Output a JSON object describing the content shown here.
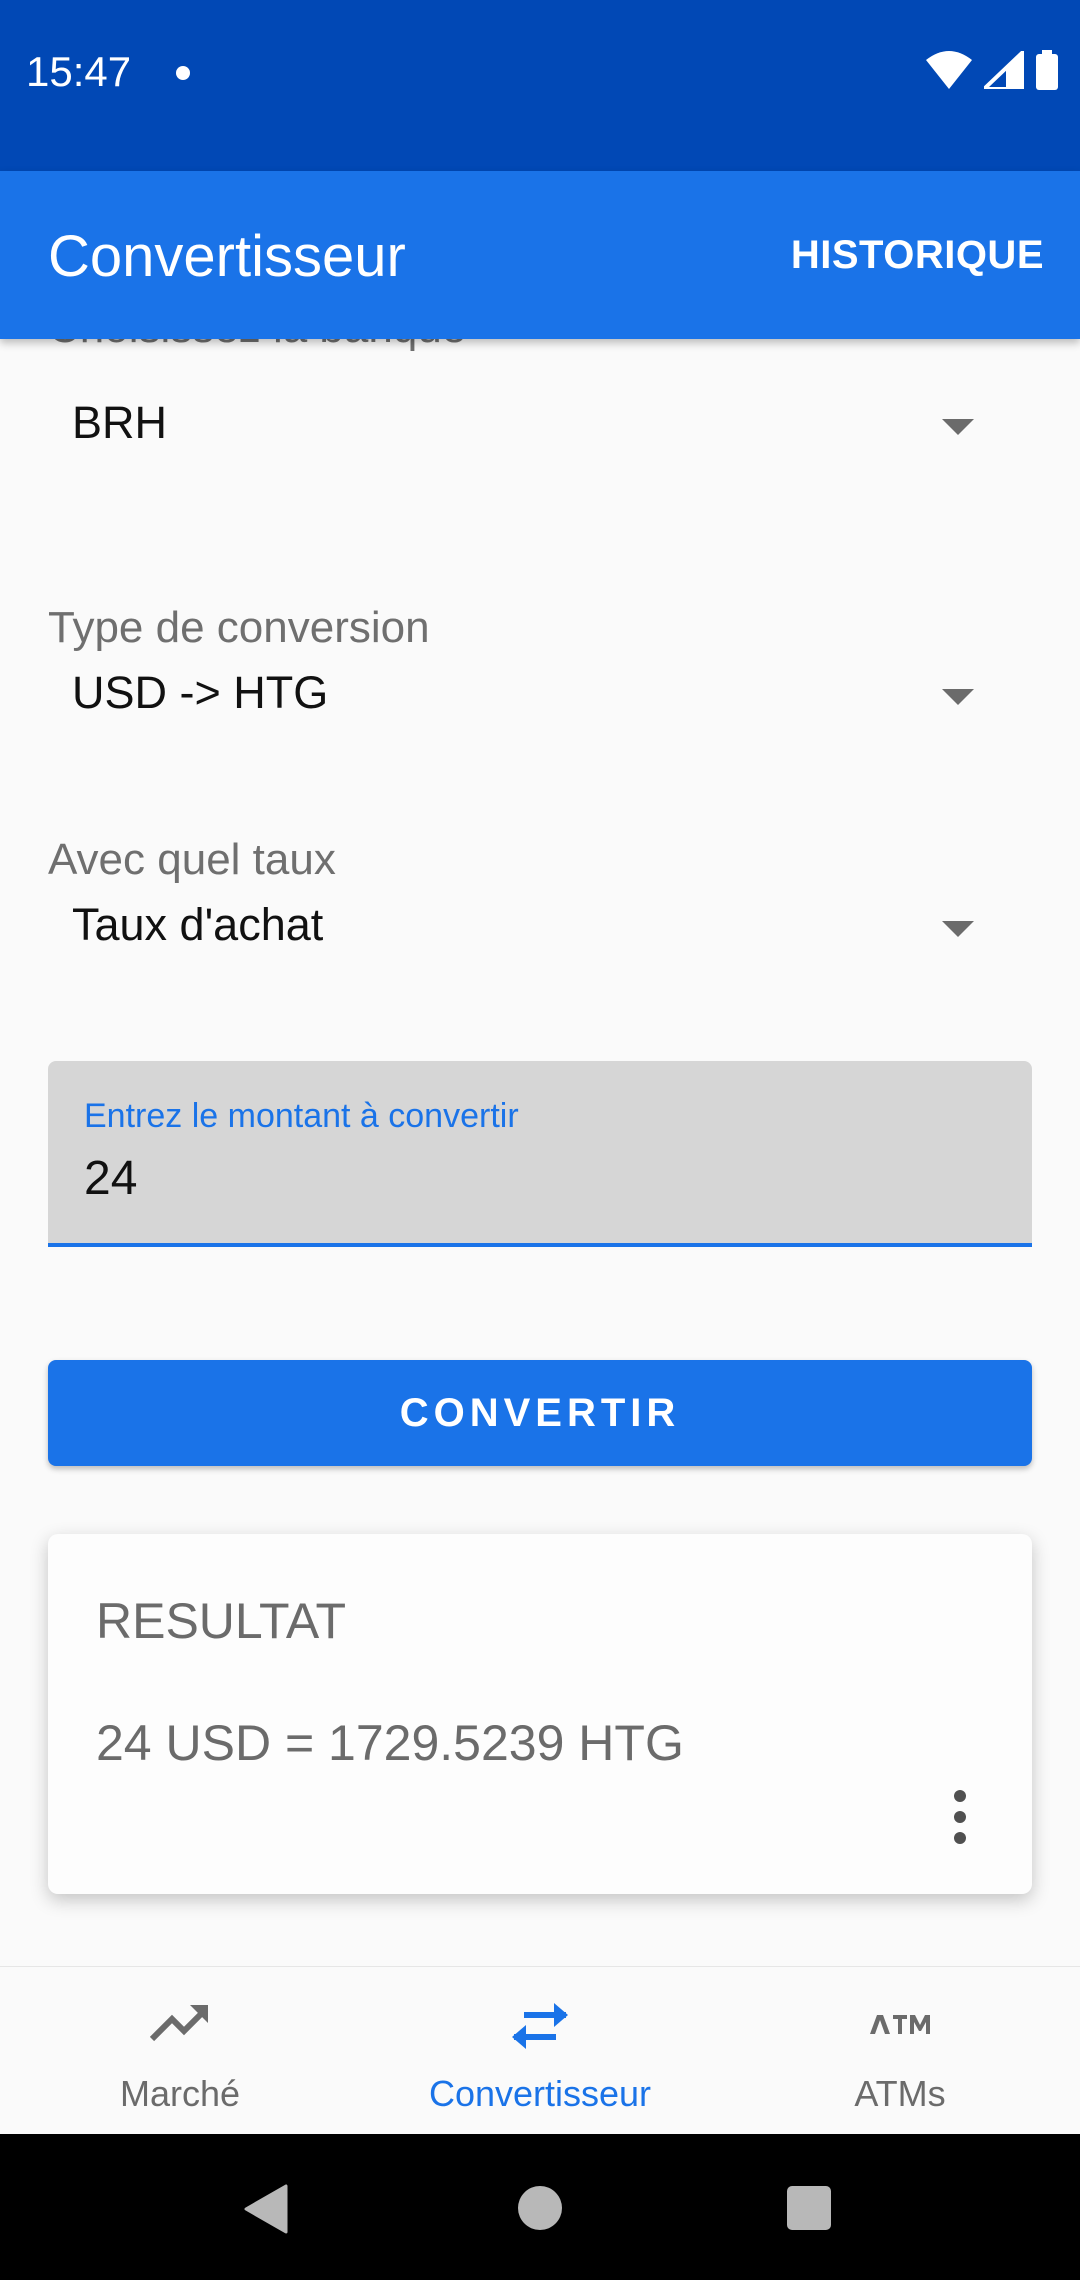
{
  "status_bar": {
    "time": "15:47"
  },
  "app_bar": {
    "title": "Convertisseur",
    "action": "HISTORIQUE"
  },
  "form": {
    "bank_label": "Choisissez la banque",
    "bank_value": "BRH",
    "conversion_label": "Type de conversion",
    "conversion_value": "USD -> HTG",
    "rate_label": "Avec quel taux",
    "rate_value": "Taux d'achat",
    "amount_label": "Entrez le montant à convertir",
    "amount_value": "24",
    "convert_button": "CONVERTIR"
  },
  "result": {
    "title": "RESULTAT",
    "text": "24 USD = 1729.5239 HTG"
  },
  "bottom_nav": [
    {
      "label": "Marché",
      "icon": "trending-up-icon",
      "active": false
    },
    {
      "label": "Convertisseur",
      "icon": "swap-icon",
      "active": true
    },
    {
      "label": "ATMs",
      "icon": "atm-icon",
      "active": false
    }
  ],
  "colors": {
    "status_bar": "#0148b5",
    "primary": "#1a73e8",
    "background": "#fafafa"
  }
}
